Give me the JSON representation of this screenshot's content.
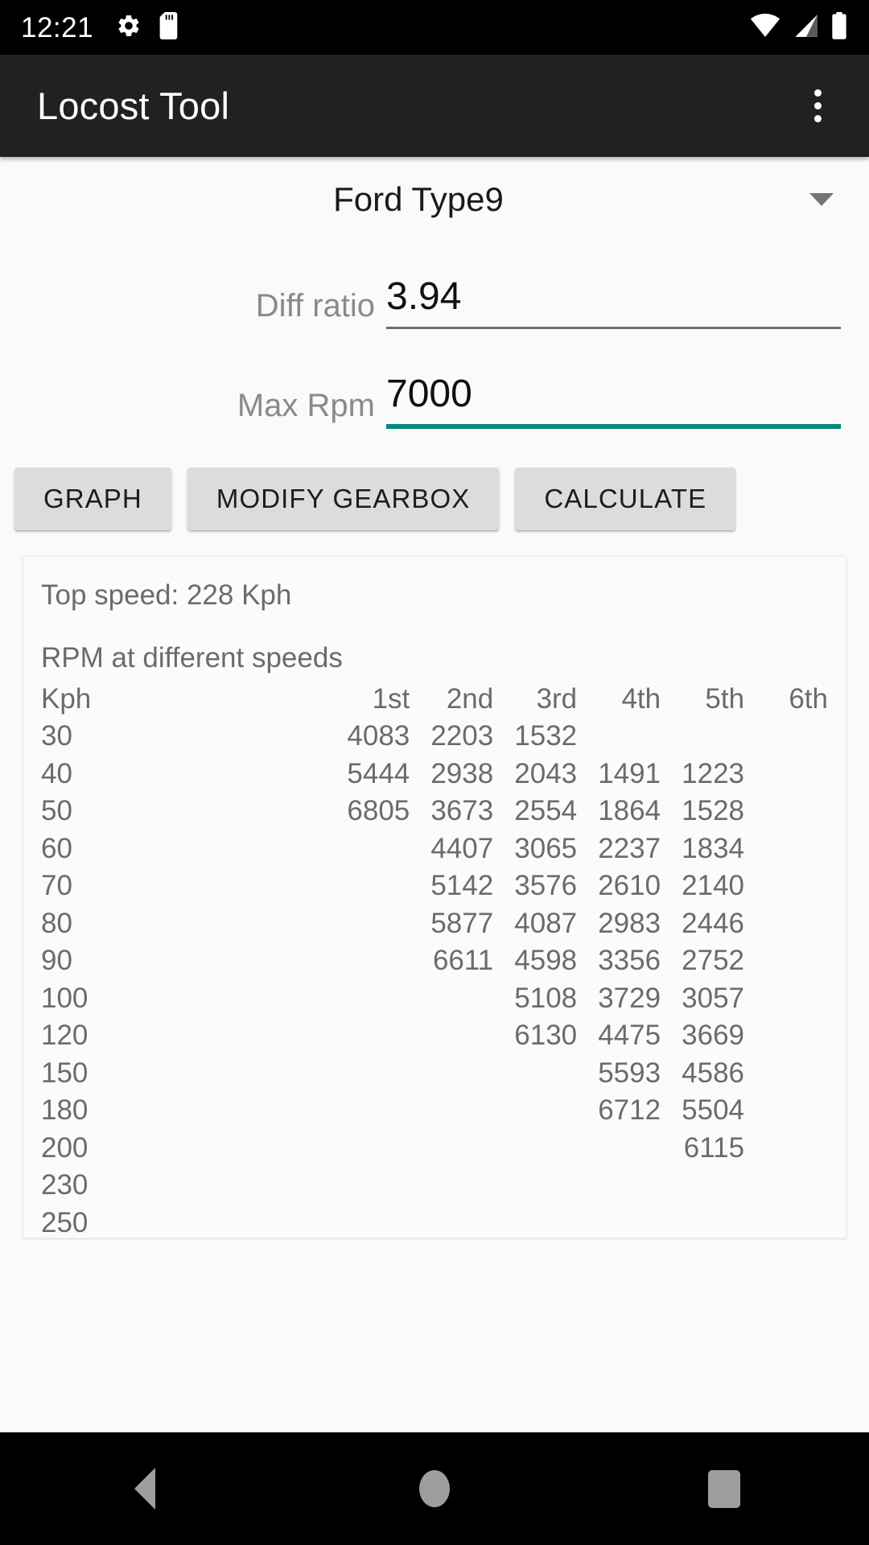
{
  "status_bar": {
    "clock": "12:21",
    "left_icons": [
      "gear-icon",
      "sd-card-icon"
    ],
    "right_icons": [
      "wifi-icon",
      "cellular-signal-icon",
      "battery-icon"
    ]
  },
  "app_bar": {
    "title": "Locost Tool",
    "overflow_icon": "more-vertical-icon"
  },
  "form": {
    "gearbox": {
      "selected": "Ford Type9",
      "caret_icon": "chevron-down-icon"
    },
    "diff_ratio": {
      "label": "Diff ratio",
      "value": "3.94",
      "focused": false
    },
    "max_rpm": {
      "label": "Max Rpm",
      "value": "7000",
      "focused": true,
      "accent_color": "#00897b"
    }
  },
  "buttons": [
    {
      "id": "graph",
      "label": "GRAPH"
    },
    {
      "id": "modify-gearbox",
      "label": "MODIFY GEARBOX"
    },
    {
      "id": "calculate",
      "label": "CALCULATE"
    }
  ],
  "results": {
    "top_speed": "Top speed: 228 Kph",
    "table_title": "RPM at different speeds",
    "columns": [
      "Kph",
      "1st",
      "2nd",
      "3rd",
      "4th",
      "5th",
      "6th"
    ],
    "rows": [
      {
        "kph": "30",
        "gears": [
          "4083",
          "2203",
          "1532",
          "",
          "",
          ""
        ]
      },
      {
        "kph": "40",
        "gears": [
          "5444",
          "2938",
          "2043",
          "1491",
          "1223",
          ""
        ]
      },
      {
        "kph": "50",
        "gears": [
          "6805",
          "3673",
          "2554",
          "1864",
          "1528",
          ""
        ]
      },
      {
        "kph": "60",
        "gears": [
          "",
          "4407",
          "3065",
          "2237",
          "1834",
          ""
        ]
      },
      {
        "kph": "70",
        "gears": [
          "",
          "5142",
          "3576",
          "2610",
          "2140",
          ""
        ]
      },
      {
        "kph": "80",
        "gears": [
          "",
          "5877",
          "4087",
          "2983",
          "2446",
          ""
        ]
      },
      {
        "kph": "90",
        "gears": [
          "",
          "6611",
          "4598",
          "3356",
          "2752",
          ""
        ]
      },
      {
        "kph": "100",
        "gears": [
          "",
          "",
          "5108",
          "3729",
          "3057",
          ""
        ]
      },
      {
        "kph": "120",
        "gears": [
          "",
          "",
          "6130",
          "4475",
          "3669",
          ""
        ]
      },
      {
        "kph": "150",
        "gears": [
          "",
          "",
          "",
          "5593",
          "4586",
          ""
        ]
      },
      {
        "kph": "180",
        "gears": [
          "",
          "",
          "",
          "6712",
          "5504",
          ""
        ]
      },
      {
        "kph": "200",
        "gears": [
          "",
          "",
          "",
          "",
          "6115",
          ""
        ]
      },
      {
        "kph": "230",
        "gears": [
          "",
          "",
          "",
          "",
          "",
          ""
        ]
      },
      {
        "kph": "250",
        "gears": [
          "",
          "",
          "",
          "",
          "",
          ""
        ]
      }
    ]
  },
  "nav_bar": {
    "back_label": "back-icon",
    "home_label": "home-icon",
    "recents_label": "recents-icon"
  }
}
